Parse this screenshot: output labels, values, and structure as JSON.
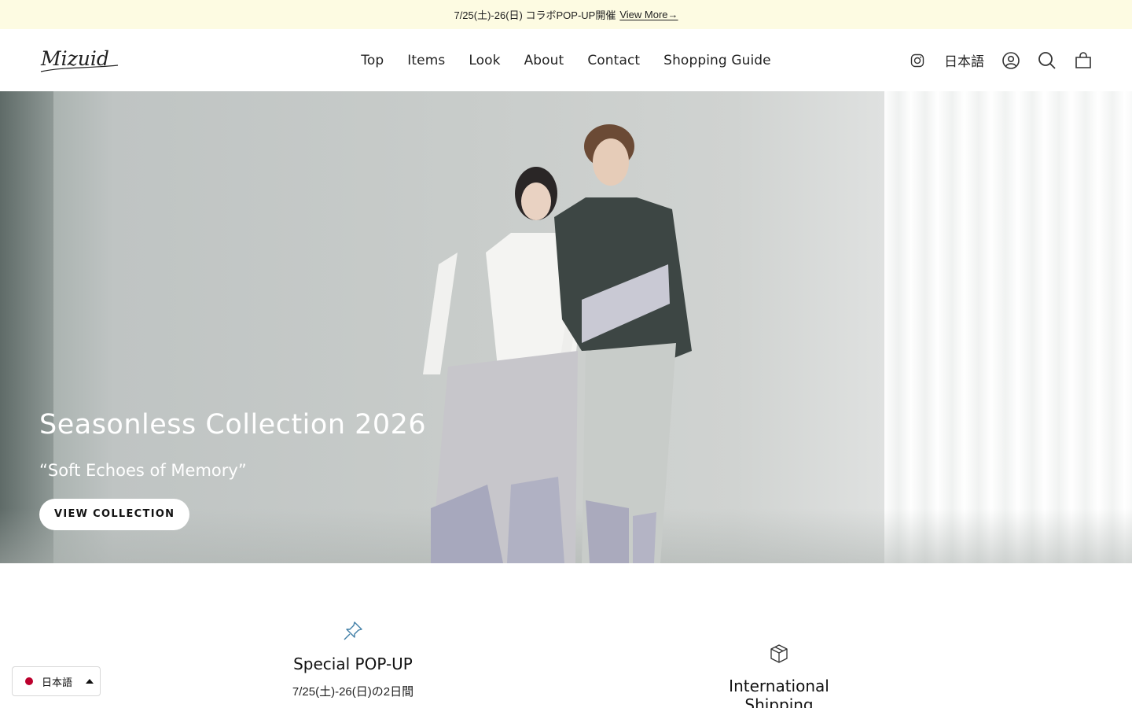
{
  "announcement": {
    "text": "7/25(土)-26(日) コラボPOP-UP開催",
    "link_label": "View More→"
  },
  "header": {
    "logo_text": "Mizuid",
    "nav": [
      {
        "label": "Top"
      },
      {
        "label": "Items"
      },
      {
        "label": "Look"
      },
      {
        "label": "About"
      },
      {
        "label": "Contact"
      },
      {
        "label": "Shopping Guide"
      }
    ],
    "language": "日本語",
    "icons": [
      "instagram-icon",
      "account-icon",
      "search-icon",
      "cart-icon"
    ]
  },
  "hero": {
    "title": "Seasonless Collection 2026",
    "subtitle": "“Soft Echoes of Memory”",
    "button_label": "VIEW COLLECTION"
  },
  "features": [
    {
      "icon": "pin-icon",
      "title": "Special POP-UP",
      "desc": "7/25(土)-26(日)の2日間"
    },
    {
      "icon": "box-icon",
      "title": "International Shipping"
    }
  ],
  "language_switcher": {
    "label": "日本語",
    "flag_color": "#bc002d"
  },
  "colors": {
    "announcement_bg": "#fdfbe2",
    "feature_icon": "#3f7ea6"
  }
}
